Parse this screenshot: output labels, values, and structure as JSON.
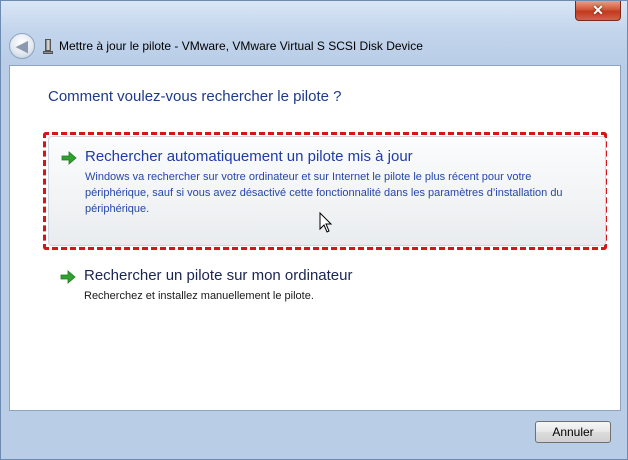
{
  "window": {
    "title": "Mettre à jour le pilote - VMware, VMware Virtual S SCSI Disk Device",
    "close_glyph": "✕"
  },
  "nav": {
    "back_glyph": "◀"
  },
  "main": {
    "heading": "Comment voulez-vous rechercher le pilote ?",
    "options": [
      {
        "title": "Rechercher automatiquement un pilote mis à jour",
        "description_lines": [
          "Windows va rechercher sur votre ordinateur et sur Internet le pilote le plus récent pour votre",
          "périphérique, sauf si vous avez désactivé cette fonctionnalité dans les paramètres d’installation du",
          "périphérique."
        ],
        "icon": "green-arrow-icon"
      },
      {
        "title": "Rechercher un pilote sur mon ordinateur",
        "description_lines": [
          "Recherchez et installez manuellement le pilote."
        ],
        "icon": "green-arrow-icon"
      }
    ]
  },
  "footer": {
    "cancel_label": "Annuler"
  },
  "colors": {
    "highlight_border": "#d8141b",
    "link_blue": "#1f3ba8",
    "arrow_green": "#2fa12f"
  }
}
